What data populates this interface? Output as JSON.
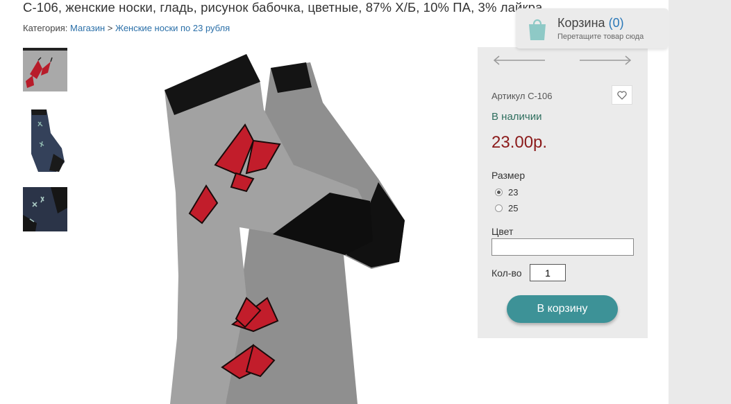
{
  "product": {
    "title": "С-106, женские носки, гладь, рисунок бабочка, цветные, 87% Х/Б, 10% ПА, 3% лайкра",
    "breadcrumb": {
      "prefix": "Категория: ",
      "shop": "Магазин",
      "separator": " > ",
      "category": "Женские носки по 23 рубля"
    },
    "sku": "Артикул С-106",
    "availability": "В наличии",
    "price": "23.00р.",
    "size_label": "Размер",
    "sizes": [
      {
        "label": "23",
        "selected": true
      },
      {
        "label": "25",
        "selected": false
      }
    ],
    "color_label": "Цвет",
    "color_value": "",
    "qty_label": "Кол-во",
    "qty_value": "1",
    "add_to_cart": "В корзину"
  },
  "cart": {
    "title": "Корзина",
    "count": "(0)",
    "hint": "Перетащите товар сюда"
  },
  "icons": {
    "prev": "arrow-left-icon",
    "next": "arrow-right-icon",
    "favorite": "heart-icon",
    "cart": "shopping-bag-icon"
  },
  "colors": {
    "accent_button": "#3d9297",
    "price": "#8b1a1a",
    "availability": "#2e6e5e",
    "link": "#2a6fa8"
  }
}
